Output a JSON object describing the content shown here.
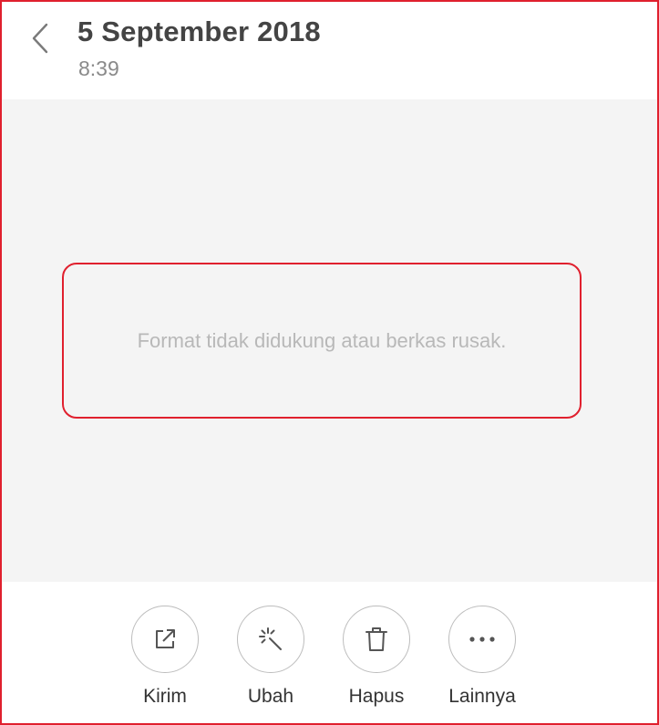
{
  "header": {
    "title": "5 September 2018",
    "time": "8:39",
    "back_icon": "chevron-left-icon"
  },
  "viewer": {
    "message": "Format tidak didukung atau berkas rusak."
  },
  "toolbar": {
    "actions": [
      {
        "label": "Kirim",
        "icon": "share-icon"
      },
      {
        "label": "Ubah",
        "icon": "magic-wand-icon"
      },
      {
        "label": "Hapus",
        "icon": "trash-icon"
      },
      {
        "label": "Lainnya",
        "icon": "more-horizontal-icon"
      }
    ]
  },
  "colors": {
    "accent_border": "#e0202e",
    "viewer_background": "#f4f4f4",
    "title_text": "#444444",
    "subtitle_text": "#8a8a8a",
    "message_text": "#b8b8b8"
  }
}
